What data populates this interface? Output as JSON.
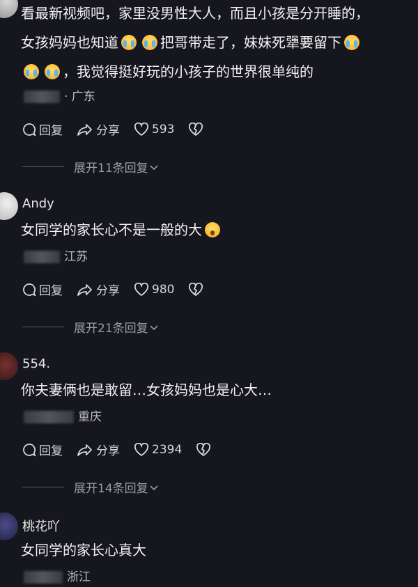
{
  "comments": [
    {
      "username": "",
      "lines": [
        "看最新视频吧，家里没男性大人，而且小孩是分开睡的，",
        [
          "女孩妈妈也知道",
          "把哥带走了，妹妹死犟要留下"
        ],
        "，我觉得挺好玩的小孩子的世界很单纯的"
      ],
      "location": "· 广东",
      "reply_label": "回复",
      "share_label": "分享",
      "likes": "593",
      "expand_label": "展开11条回复"
    },
    {
      "username": "Andy",
      "text": "女同学的家长心不是一般的大",
      "location": "江苏",
      "reply_label": "回复",
      "share_label": "分享",
      "likes": "980",
      "expand_label": "展开21条回复"
    },
    {
      "username": "554.",
      "text": "你夫妻俩也是敢留…女孩妈妈也是心大…",
      "location": "重庆",
      "reply_label": "回复",
      "share_label": "分享",
      "likes": "2394",
      "expand_label": "展开14条回复"
    },
    {
      "username": "桃花吖",
      "text": "女同学的家长心真大",
      "location": "浙江"
    }
  ],
  "icons": {
    "reply": "speech-bubble-icon",
    "share": "share-arrow-icon",
    "like": "heart-icon",
    "dislike": "broken-heart-icon",
    "expand": "chevron-down-icon"
  },
  "colors": {
    "background": "#16161e",
    "text": "#f2f2f2",
    "muted": "#9c9ca3"
  }
}
